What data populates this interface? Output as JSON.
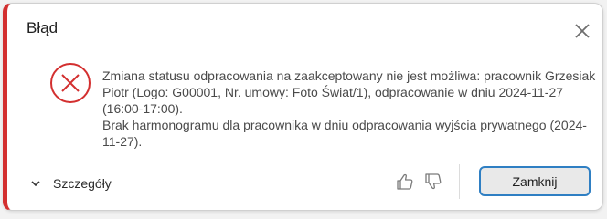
{
  "dialog": {
    "title": "Błąd",
    "message_line1": "Zmiana statusu odpracowania na zaakceptowany nie jest możliwa: pracownik Grzesiak Piotr (Logo: G00001, Nr. umowy: Foto Świat/1), odpracowanie w dniu 2024-11-27 (16:00-17:00).",
    "message_line2": "Brak harmonogramu dla pracownika w dniu odpracowania wyjścia prywatnego (2024-11-27).",
    "details_label": "Szczegóły",
    "close_button_label": "Zamknij",
    "icons": {
      "close": "close-icon",
      "error": "error-circle-x-icon",
      "expand": "chevron-down-icon",
      "like": "thumbs-up-icon",
      "dislike": "thumbs-down-icon"
    },
    "colors": {
      "error_accent": "#d32f2f",
      "button_border": "#2f7fc3"
    }
  }
}
